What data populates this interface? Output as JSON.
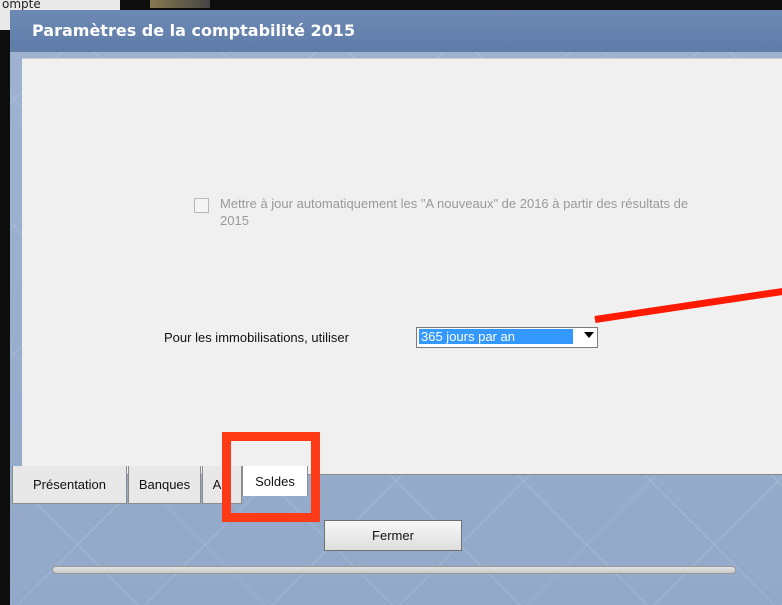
{
  "background_app": {
    "text": "ompte"
  },
  "window": {
    "title": "Paramètres de la comptabilité 2015"
  },
  "settings": {
    "update_checkbox_label": "Mettre à jour automatiquement les \"A nouveaux\" de 2016 à partir des résultats de 2015",
    "update_checkbox_checked": false,
    "immobilisations_label": "Pour les immobilisations, utiliser",
    "immobilisations_value": "365 jours par an"
  },
  "tabs": [
    {
      "label": "Présentation"
    },
    {
      "label": "Banques"
    },
    {
      "label": "AG"
    },
    {
      "label": "Soldes",
      "active": true
    }
  ],
  "buttons": {
    "close_label": "Fermer"
  },
  "colors": {
    "title_bar": "#6d89b4",
    "selection": "#3399ff",
    "annotation": "#ff3a17"
  }
}
